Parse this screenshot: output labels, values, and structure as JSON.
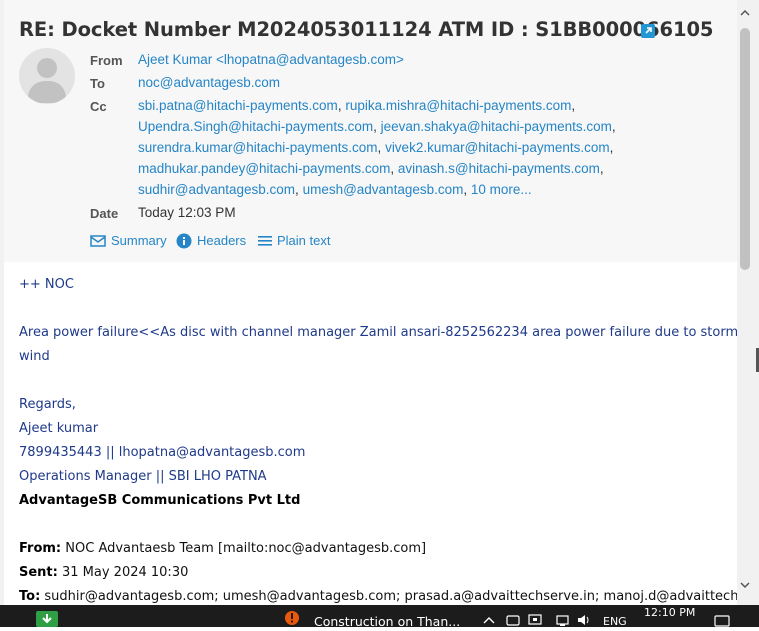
{
  "email": {
    "subject": "RE: Docket Number M2024053011124 ATM ID : S1BB000066105",
    "labels": {
      "from": "From",
      "to": "To",
      "cc": "Cc",
      "date": "Date"
    },
    "from": "Ajeet Kumar <lhopatna@advantagesb.com>",
    "to": "noc@advantagesb.com",
    "cc": [
      "sbi.patna@hitachi-payments.com",
      "rupika.mishra@hitachi-payments.com",
      "Upendra.Singh@hitachi-payments.com",
      "jeevan.shakya@hitachi-payments.com",
      "surendra.kumar@hitachi-payments.com",
      "vivek2.kumar@hitachi-payments.com",
      "madhukar.pandey@hitachi-payments.com",
      "avinash.s@hitachi-payments.com",
      "sudhir@advantagesb.com",
      "umesh@advantagesb.com"
    ],
    "cc_more": "10 more...",
    "date": "Today 12:03 PM",
    "views": {
      "summary": "Summary",
      "headers": "Headers",
      "plain": "Plain text"
    }
  },
  "body": {
    "line1": "++ NOC",
    "line2": "Area power failure<<As disc with channel manager Zamil ansari-8252562234 area power failure due to storm & high",
    "line3": "wind",
    "regards": "Regards,",
    "name": "Ajeet kumar",
    "phone": "7899435443 || lhopatna@advantagesb.com",
    "role": "Operations Manager || SBI LHO PATNA",
    "company": "AdvantageSB Communications Pvt Ltd",
    "quoted": {
      "from_label": "From:",
      "from_value": " NOC Advantaesb Team [mailto:noc@advantagesb.com]",
      "sent_label": "Sent:",
      "sent_value": " 31 May 2024 10:30",
      "to_label": "To:",
      "to_value": " sudhir@advantagesb.com; umesh@advantagesb.com; prasad.a@advaittechserve.in; manoj.d@advaittechserve.in"
    }
  },
  "taskbar": {
    "weather": "Construction on Than...",
    "lang": "ENG",
    "time": "12:10 PM"
  },
  "colors": {
    "link": "#2585c6",
    "body_text": "#1f3a8a",
    "header_bg": "#f7f7f7"
  }
}
